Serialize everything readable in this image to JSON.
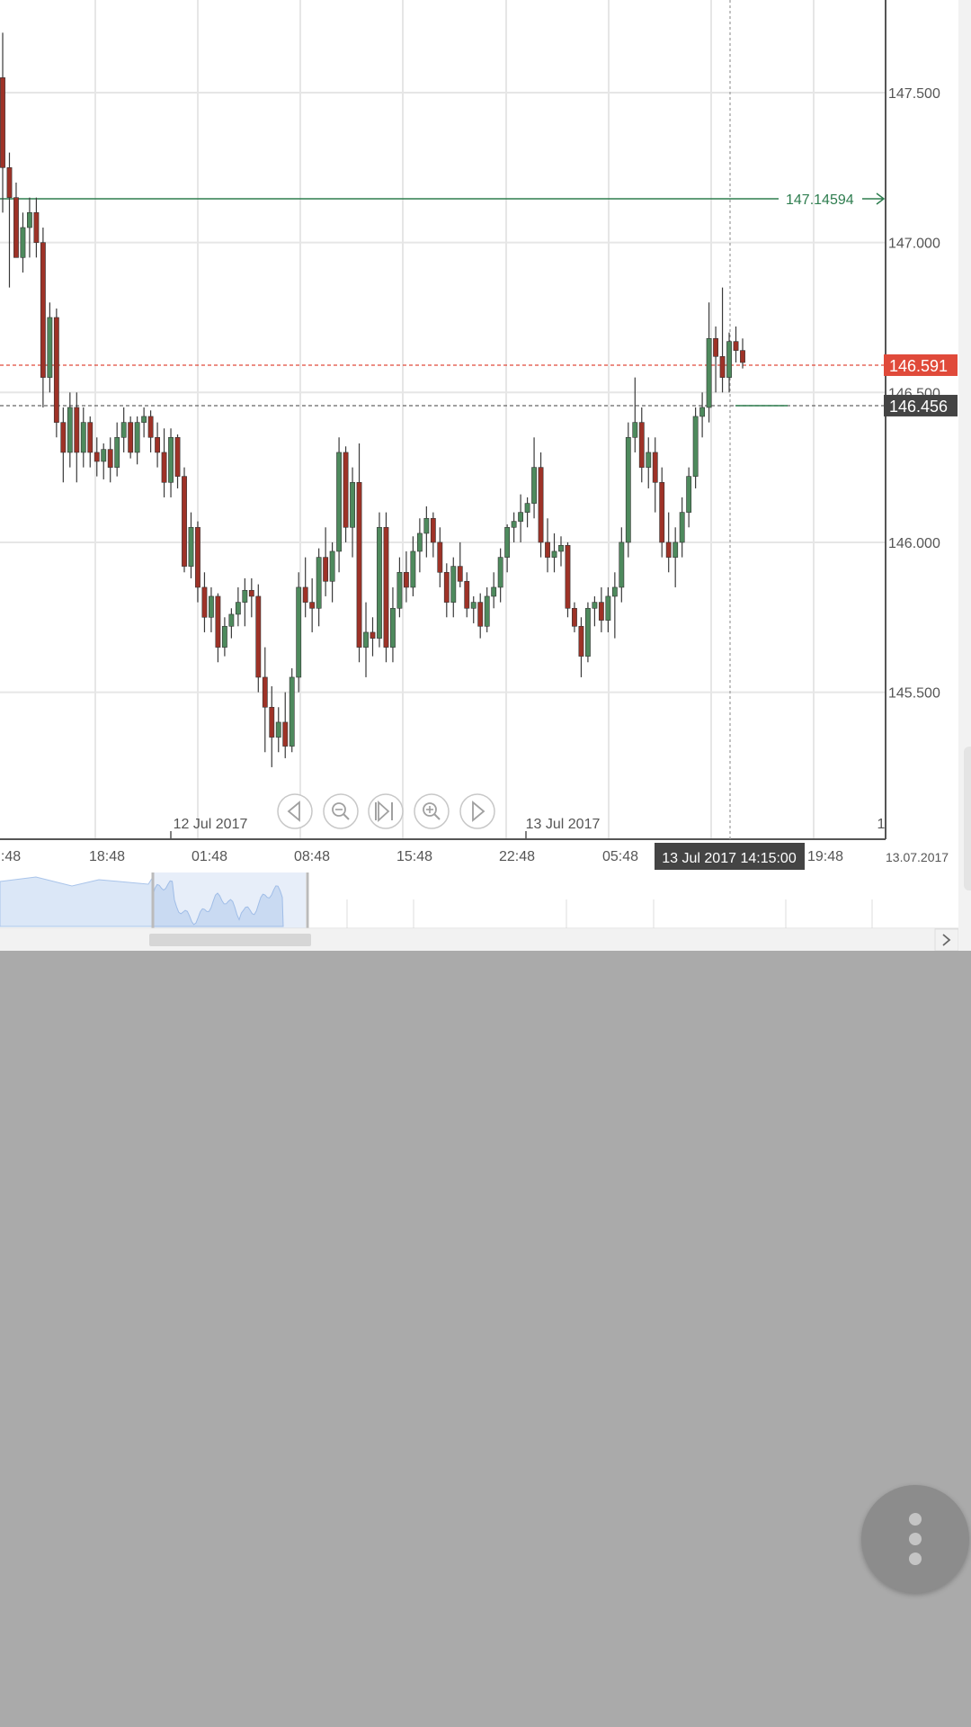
{
  "chart_data": {
    "type": "candlestick",
    "instrument_range": {
      "y_min": 145.1,
      "y_max": 147.8
    },
    "y_ticks": [
      {
        "value": 147.5,
        "label": "147.500"
      },
      {
        "value": 147.0,
        "label": "147.000"
      },
      {
        "value": 146.5,
        "label": "146.500"
      },
      {
        "value": 146.0,
        "label": "146.000"
      },
      {
        "value": 145.5,
        "label": "145.500"
      }
    ],
    "x_ticks": [
      ":48",
      "18:48",
      "01:48",
      "08:48",
      "15:48",
      "22:48",
      "05:48",
      "19:48"
    ],
    "x_end_label": "13.07.2017",
    "date_markers": [
      "12 Jul 2017",
      "13 Jul 2017"
    ],
    "axis_corner_label": "1",
    "grid": true,
    "horizontal_line": {
      "value": 147.14594,
      "label": "147.14594",
      "color": "#2e7d4f"
    },
    "current_price": {
      "value": 146.591,
      "label": "146.591",
      "color": "#e04a3a"
    },
    "crosshair": {
      "value": 146.456,
      "label": "146.456",
      "time_label": "13 Jul 2017 14:15:00"
    },
    "colors": {
      "up": "#4e8a5d",
      "down": "#9e3227",
      "wick": "#3a3a3a",
      "grid": "#e6e6e6"
    },
    "candles": [
      [
        147.55,
        147.7,
        147.1,
        147.25
      ],
      [
        147.25,
        147.3,
        146.85,
        147.15
      ],
      [
        147.15,
        147.2,
        146.95,
        146.95
      ],
      [
        146.95,
        147.1,
        146.9,
        147.05
      ],
      [
        147.05,
        147.15,
        146.95,
        147.1
      ],
      [
        147.1,
        147.15,
        146.95,
        147.0
      ],
      [
        147.0,
        147.05,
        146.45,
        146.55
      ],
      [
        146.55,
        146.8,
        146.5,
        146.75
      ],
      [
        146.75,
        146.78,
        146.35,
        146.4
      ],
      [
        146.4,
        146.45,
        146.2,
        146.3
      ],
      [
        146.3,
        146.5,
        146.25,
        146.45
      ],
      [
        146.45,
        146.5,
        146.2,
        146.3
      ],
      [
        146.3,
        146.45,
        146.25,
        146.4
      ],
      [
        146.4,
        146.42,
        146.25,
        146.3
      ],
      [
        146.3,
        146.35,
        146.22,
        146.27
      ],
      [
        146.27,
        146.33,
        146.21,
        146.31
      ],
      [
        146.31,
        146.35,
        146.2,
        146.25
      ],
      [
        146.25,
        146.4,
        146.22,
        146.35
      ],
      [
        146.35,
        146.45,
        146.3,
        146.4
      ],
      [
        146.4,
        146.42,
        146.28,
        146.3
      ],
      [
        146.3,
        146.42,
        146.26,
        146.4
      ],
      [
        146.4,
        146.45,
        146.35,
        146.42
      ],
      [
        146.42,
        146.44,
        146.3,
        146.35
      ],
      [
        146.35,
        146.4,
        146.25,
        146.3
      ],
      [
        146.3,
        146.38,
        146.15,
        146.2
      ],
      [
        146.2,
        146.38,
        146.15,
        146.35
      ],
      [
        146.35,
        146.36,
        146.18,
        146.22
      ],
      [
        146.22,
        146.25,
        145.9,
        145.92
      ],
      [
        145.92,
        146.1,
        145.88,
        146.05
      ],
      [
        146.05,
        146.07,
        145.8,
        145.85
      ],
      [
        145.85,
        145.9,
        145.7,
        145.75
      ],
      [
        145.75,
        145.85,
        145.7,
        145.82
      ],
      [
        145.82,
        145.83,
        145.6,
        145.65
      ],
      [
        145.65,
        145.75,
        145.62,
        145.72
      ],
      [
        145.72,
        145.78,
        145.68,
        145.76
      ],
      [
        145.76,
        145.85,
        145.72,
        145.8
      ],
      [
        145.8,
        145.88,
        145.72,
        145.84
      ],
      [
        145.84,
        145.88,
        145.75,
        145.82
      ],
      [
        145.82,
        145.86,
        145.5,
        145.55
      ],
      [
        145.55,
        145.65,
        145.3,
        145.45
      ],
      [
        145.45,
        145.52,
        145.25,
        145.35
      ],
      [
        145.35,
        145.45,
        145.3,
        145.4
      ],
      [
        145.4,
        145.5,
        145.28,
        145.32
      ],
      [
        145.32,
        145.58,
        145.3,
        145.55
      ],
      [
        145.55,
        145.9,
        145.5,
        145.85
      ],
      [
        145.85,
        145.95,
        145.75,
        145.8
      ],
      [
        145.8,
        145.88,
        145.7,
        145.78
      ],
      [
        145.78,
        145.98,
        145.72,
        145.95
      ],
      [
        145.95,
        146.05,
        145.82,
        145.87
      ],
      [
        145.87,
        146.0,
        145.8,
        145.97
      ],
      [
        145.97,
        146.35,
        145.9,
        146.3
      ],
      [
        146.3,
        146.32,
        146.0,
        146.05
      ],
      [
        146.05,
        146.25,
        145.95,
        146.2
      ],
      [
        146.2,
        146.33,
        145.6,
        145.65
      ],
      [
        145.65,
        145.8,
        145.55,
        145.7
      ],
      [
        145.7,
        145.75,
        145.62,
        145.68
      ],
      [
        145.68,
        146.1,
        145.65,
        146.05
      ],
      [
        146.05,
        146.1,
        145.6,
        145.65
      ],
      [
        145.65,
        145.85,
        145.6,
        145.78
      ],
      [
        145.78,
        145.95,
        145.75,
        145.9
      ],
      [
        145.9,
        145.97,
        145.8,
        145.85
      ],
      [
        145.85,
        146.02,
        145.82,
        145.97
      ],
      [
        145.97,
        146.08,
        145.9,
        146.03
      ],
      [
        146.03,
        146.12,
        145.95,
        146.08
      ],
      [
        146.08,
        146.1,
        145.95,
        146.0
      ],
      [
        146.0,
        146.05,
        145.85,
        145.9
      ],
      [
        145.9,
        145.93,
        145.75,
        145.8
      ],
      [
        145.8,
        145.95,
        145.75,
        145.92
      ],
      [
        145.92,
        146.0,
        145.85,
        145.87
      ],
      [
        145.87,
        145.9,
        145.75,
        145.78
      ],
      [
        145.78,
        145.82,
        145.73,
        145.8
      ],
      [
        145.8,
        145.83,
        145.68,
        145.72
      ],
      [
        145.72,
        145.85,
        145.7,
        145.82
      ],
      [
        145.82,
        145.9,
        145.78,
        145.85
      ],
      [
        145.85,
        145.98,
        145.8,
        145.95
      ],
      [
        145.95,
        146.06,
        145.9,
        146.05
      ],
      [
        146.05,
        146.1,
        146.0,
        146.07
      ],
      [
        146.07,
        146.16,
        146.0,
        146.1
      ],
      [
        146.1,
        146.15,
        146.05,
        146.13
      ],
      [
        146.13,
        146.35,
        146.08,
        146.25
      ],
      [
        146.25,
        146.3,
        145.95,
        146.0
      ],
      [
        146.0,
        146.08,
        145.9,
        145.95
      ],
      [
        145.95,
        146.03,
        145.9,
        145.97
      ],
      [
        145.97,
        146.02,
        145.92,
        145.99
      ],
      [
        145.99,
        146.0,
        145.75,
        145.78
      ],
      [
        145.78,
        145.8,
        145.7,
        145.72
      ],
      [
        145.72,
        145.75,
        145.55,
        145.62
      ],
      [
        145.62,
        145.8,
        145.6,
        145.78
      ],
      [
        145.78,
        145.82,
        145.72,
        145.8
      ],
      [
        145.8,
        145.85,
        145.7,
        145.74
      ],
      [
        145.74,
        145.85,
        145.7,
        145.82
      ],
      [
        145.82,
        145.9,
        145.68,
        145.85
      ],
      [
        145.85,
        146.05,
        145.8,
        146.0
      ],
      [
        146.0,
        146.4,
        145.95,
        146.35
      ],
      [
        146.35,
        146.55,
        146.3,
        146.4
      ],
      [
        146.4,
        146.45,
        146.2,
        146.25
      ],
      [
        146.25,
        146.35,
        146.18,
        146.3
      ],
      [
        146.3,
        146.35,
        146.1,
        146.2
      ],
      [
        146.2,
        146.25,
        145.95,
        146.0
      ],
      [
        146.0,
        146.1,
        145.9,
        145.95
      ],
      [
        145.95,
        146.05,
        145.85,
        146.0
      ],
      [
        146.0,
        146.15,
        145.95,
        146.1
      ],
      [
        146.1,
        146.25,
        146.05,
        146.22
      ],
      [
        146.22,
        146.45,
        146.18,
        146.42
      ],
      [
        146.42,
        146.5,
        146.35,
        146.45
      ],
      [
        146.45,
        146.8,
        146.4,
        146.68
      ],
      [
        146.68,
        146.72,
        146.5,
        146.62
      ],
      [
        146.62,
        146.85,
        146.5,
        146.55
      ],
      [
        146.55,
        146.7,
        146.5,
        146.67
      ],
      [
        146.67,
        146.72,
        146.6,
        146.64
      ],
      [
        146.64,
        146.68,
        146.58,
        146.6
      ]
    ]
  },
  "icons": [
    "arrow-left-icon",
    "zoom-out-icon",
    "skip-to-end-icon",
    "zoom-in-icon",
    "arrow-right-icon"
  ],
  "fab": {
    "icon": "more-vertical-icon"
  }
}
